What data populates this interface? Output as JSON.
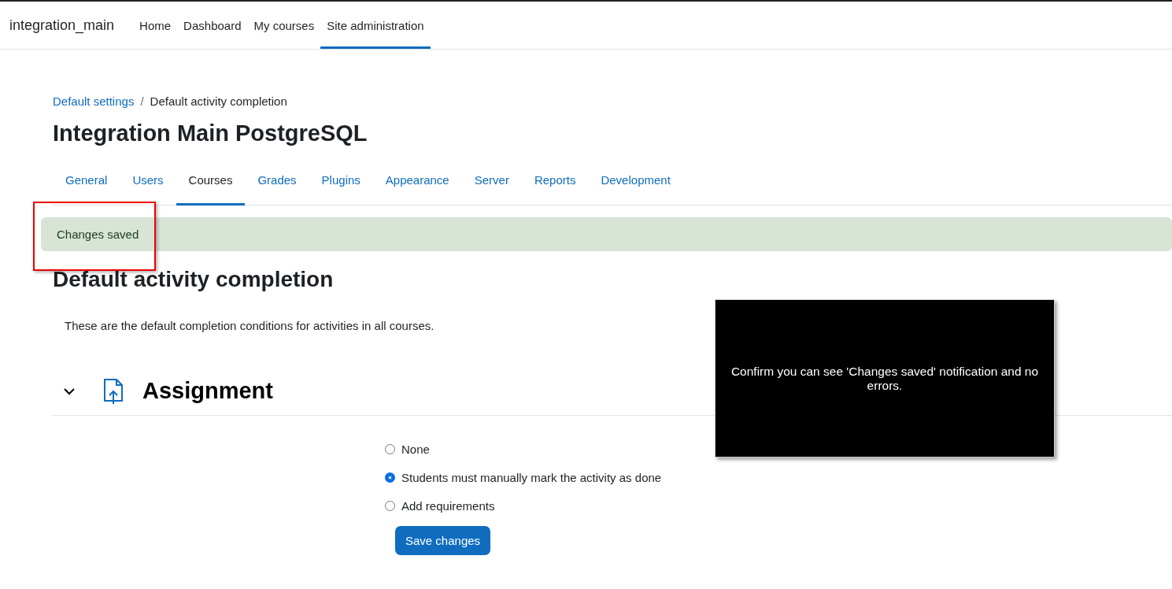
{
  "navbar": {
    "brand": "integration_main",
    "items": [
      {
        "label": "Home",
        "selected": false
      },
      {
        "label": "Dashboard",
        "selected": false
      },
      {
        "label": "My courses",
        "selected": false
      },
      {
        "label": "Site administration",
        "selected": true
      }
    ]
  },
  "breadcrumb": {
    "separator": "/",
    "items": [
      {
        "label": "Default settings",
        "kind": "link"
      },
      {
        "label": "Default activity completion",
        "kind": "current"
      }
    ]
  },
  "page_title": "Integration Main PostgreSQL",
  "tabs": [
    {
      "label": "General",
      "selected": false
    },
    {
      "label": "Users",
      "selected": false
    },
    {
      "label": "Courses",
      "selected": true
    },
    {
      "label": "Grades",
      "selected": false
    },
    {
      "label": "Plugins",
      "selected": false
    },
    {
      "label": "Appearance",
      "selected": false
    },
    {
      "label": "Server",
      "selected": false
    },
    {
      "label": "Reports",
      "selected": false
    },
    {
      "label": "Development",
      "selected": false
    }
  ],
  "alert": {
    "text": "Changes saved"
  },
  "heading": "Default activity completion",
  "description": "These are the default completion conditions for activities in all courses.",
  "section": {
    "title": "Assignment",
    "expanded": true,
    "options": [
      {
        "label": "None",
        "selected": false
      },
      {
        "label": "Students must manually mark the activity as done",
        "selected": true
      },
      {
        "label": "Add requirements",
        "selected": false
      }
    ],
    "button": "Save changes"
  },
  "callout": {
    "text": "Confirm you can see 'Changes saved' notification and no errors."
  }
}
